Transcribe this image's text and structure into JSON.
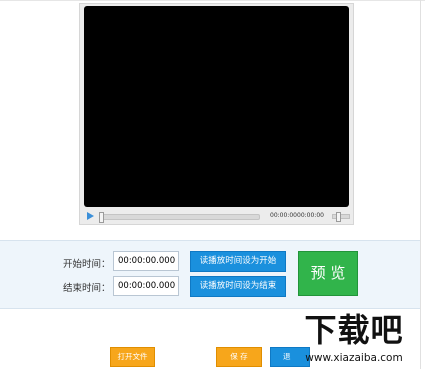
{
  "player": {
    "current_time": "00:00:00",
    "total_time": "00:00:00"
  },
  "time_panel": {
    "start_label": "开始时间：",
    "end_label": "结束时间：",
    "start_value": "00:00:00.000",
    "end_value": "00:00:00.000",
    "set_start_button": "读播放时间设为开始",
    "set_end_button": "读播放时间设为结束",
    "preview_button": "预 览"
  },
  "footer": {
    "open_file_button": "打开文件",
    "save_button": "保 存",
    "third_button": "退"
  },
  "watermark": {
    "logo": "下载吧",
    "url": "www.xiazaiba.com"
  },
  "colors": {
    "accent_blue": "#1a90dd",
    "preview_green": "#31b44b",
    "button_orange": "#f7a61b",
    "panel_bg": "#eef5fb"
  }
}
